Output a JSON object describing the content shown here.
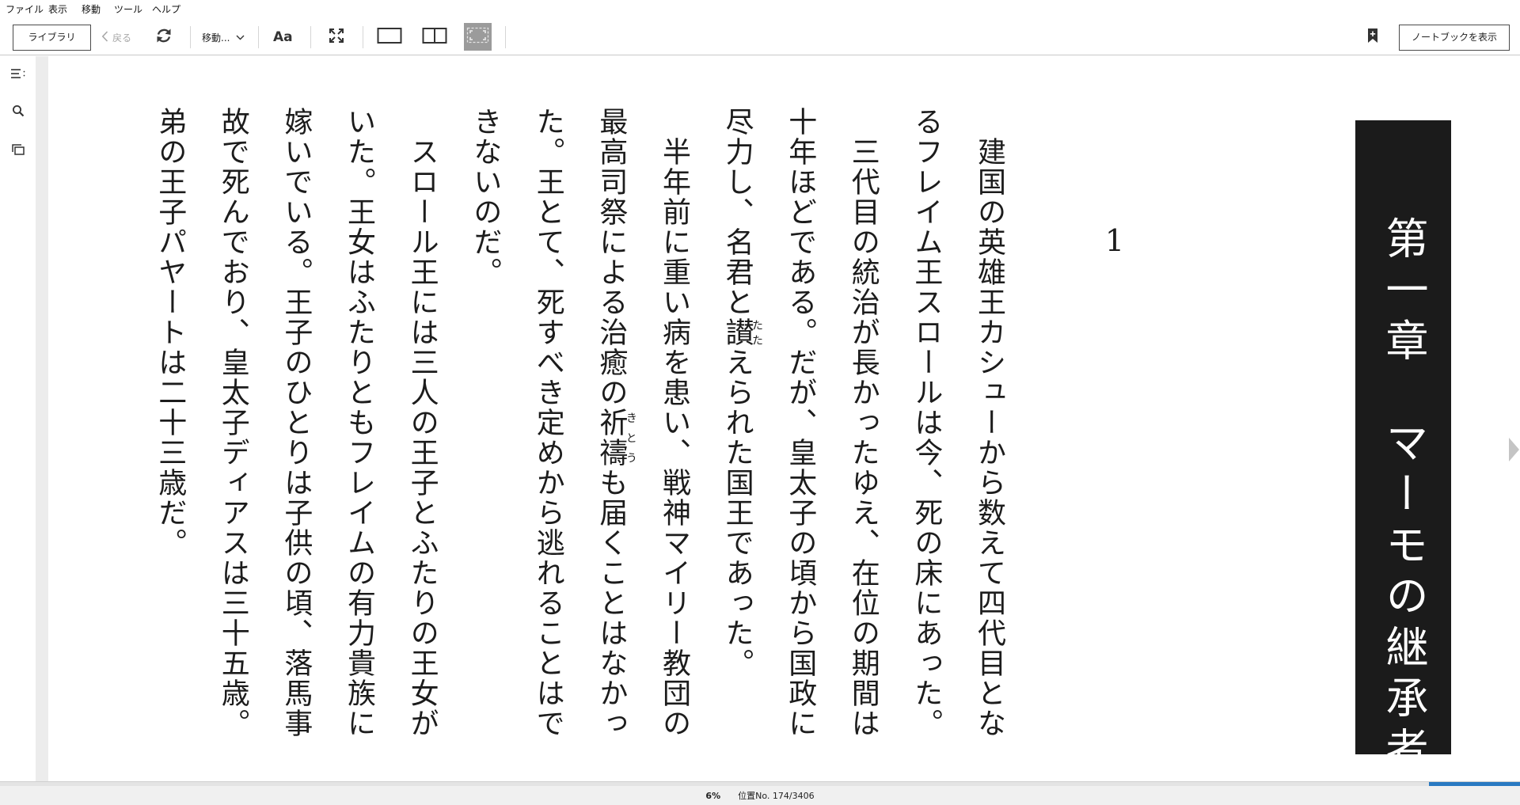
{
  "menu": {
    "items": [
      "ファイル",
      "表示",
      "移動",
      "ツール",
      "ヘルプ"
    ]
  },
  "toolbar": {
    "library_label": "ライブラリ",
    "back_label": "戻る",
    "goto_label": "移動...",
    "font_label": "Aa",
    "notebook_label": "ノートブックを表示"
  },
  "icons": {
    "back": "chevron-left-icon",
    "sync": "refresh-icon",
    "goto": "chevron-down-icon",
    "fullscreen": "fullscreen-icon",
    "single_page": "single-page-icon",
    "two_page": "two-page-icon",
    "fit": "fit-page-icon",
    "bookmark": "bookmark-add-icon",
    "sidebar": [
      "table-of-contents-icon",
      "search-icon",
      "flashcards-icon"
    ]
  },
  "book": {
    "chapter_title": "第一章　マーモの継承者",
    "section_number": "1",
    "columns": [
      {
        "segments": [
          {
            "text": "　建国の英雄王カシューから数えて四代目とな"
          }
        ]
      },
      {
        "segments": [
          {
            "text": "るフレイム王スロールは今、死の床にあった。"
          }
        ]
      },
      {
        "segments": [
          {
            "text": "　三代目の統治が長かったゆえ、在位の期間は"
          }
        ]
      },
      {
        "segments": [
          {
            "text": "十年ほどである。だが、皇太子の頃から国政に"
          }
        ]
      },
      {
        "segments": [
          {
            "text": "尽力し、名君と"
          },
          {
            "base": "讃",
            "ruby": "たた"
          },
          {
            "text": "えられた国王であった。"
          }
        ]
      },
      {
        "segments": [
          {
            "text": "　半年前に重い病を患い、戦神マイリー教団の"
          }
        ]
      },
      {
        "segments": [
          {
            "text": "最高司祭による治癒の"
          },
          {
            "base": "祈禱",
            "ruby": "きとう"
          },
          {
            "text": "も届くことはなかっ"
          }
        ]
      },
      {
        "segments": [
          {
            "text": "た。王とて、死すべき定めから逃れることはで"
          }
        ]
      },
      {
        "segments": [
          {
            "text": "きないのだ。"
          }
        ]
      },
      {
        "segments": [
          {
            "text": "　スロール王には三人の王子とふたりの王女が"
          }
        ]
      },
      {
        "segments": [
          {
            "text": "いた。王女はふたりともフレイムの有力貴族に"
          }
        ]
      },
      {
        "segments": [
          {
            "text": "嫁いでいる。王子のひとりは子供の頃、落馬事"
          }
        ]
      },
      {
        "segments": [
          {
            "text": "故で死んでおり、皇太子ディアスは三十五歳。"
          }
        ]
      },
      {
        "segments": [
          {
            "text": "弟の王子パヤートは二十三歳だ。"
          }
        ]
      }
    ]
  },
  "status": {
    "percent": "6%",
    "location": "位置No. 174/3406",
    "progress_fraction": 0.06
  },
  "colors": {
    "progress": "#2a7ac2",
    "chapter_bg": "#1b1b1b",
    "chapter_text": "#ffffff",
    "selected_tool_bg": "#9b9b9b"
  }
}
